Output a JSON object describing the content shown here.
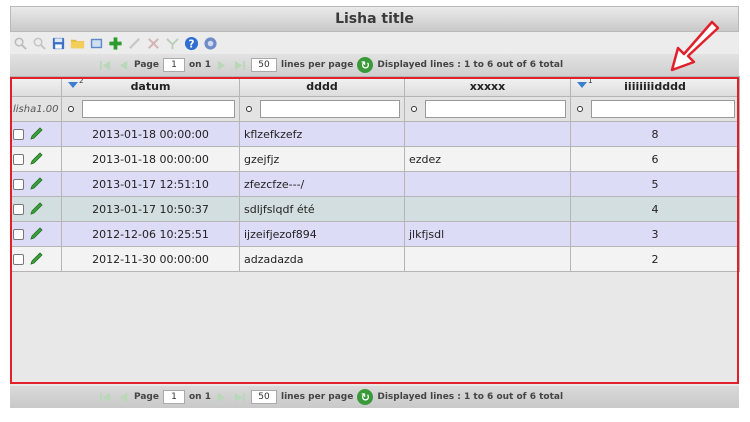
{
  "window": {
    "title": "Lisha title"
  },
  "toolbar": {
    "icons": [
      "search-icon",
      "clear-search-icon",
      "save-icon",
      "folder-icon",
      "copy-icon",
      "add-icon",
      "edit-icon",
      "delete-icon",
      "merge-icon",
      "help-icon",
      "settings-icon"
    ]
  },
  "pager": {
    "page_label": "Page",
    "page_value": "1",
    "on_label": "on 1",
    "lines_value": "50",
    "lines_label": "lines per page",
    "displayed": "Displayed lines : 1 to 6 out of 6 total"
  },
  "grid": {
    "row_label": "lisha1.00",
    "columns": [
      {
        "key": "datum",
        "label": "datum",
        "sort_order": "2"
      },
      {
        "key": "dddd",
        "label": "dddd",
        "sort_order": ""
      },
      {
        "key": "xxxxx",
        "label": "xxxxx",
        "sort_order": ""
      },
      {
        "key": "num",
        "label": "iiiiiiiidddd",
        "sort_order": "1"
      }
    ],
    "rows": [
      {
        "datum": "2013-01-18 00:00:00",
        "dddd": "kflzefkzefz",
        "xxxxx": "",
        "num": "8"
      },
      {
        "datum": "2013-01-18 00:00:00",
        "dddd": "gzejfjz",
        "xxxxx": "ezdez",
        "num": "6"
      },
      {
        "datum": "2013-01-17 12:51:10",
        "dddd": "zfezcfze---/",
        "xxxxx": "",
        "num": "5"
      },
      {
        "datum": "2013-01-17 10:50:37",
        "dddd": "sdljfslqdf été",
        "xxxxx": "",
        "num": "4"
      },
      {
        "datum": "2012-12-06 10:25:51",
        "dddd": "ijzeifjezof894",
        "xxxxx": "jlkfjsdl",
        "num": "3"
      },
      {
        "datum": "2012-11-30 00:00:00",
        "dddd": "adzadazda",
        "xxxxx": "",
        "num": "2"
      }
    ]
  },
  "colors": {
    "highlight_border": "#e0212b",
    "row_odd": "#dcdcf7",
    "row_even": "#f3f3f3",
    "row_selected": "#d2dee0"
  }
}
